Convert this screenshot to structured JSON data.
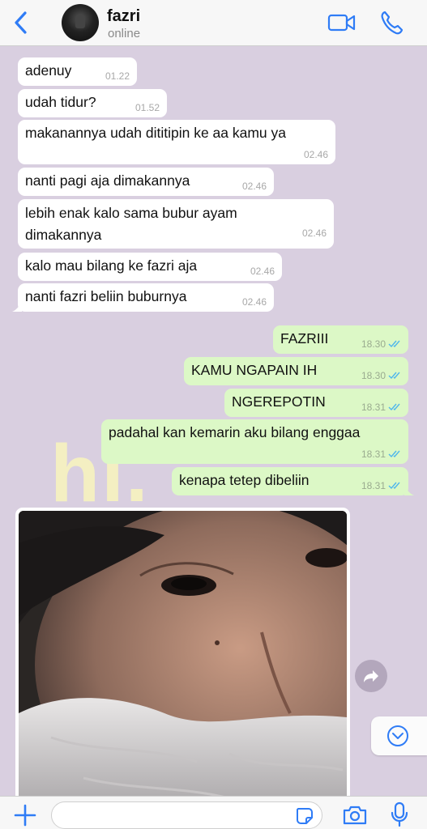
{
  "header": {
    "contact_name": "fazri",
    "contact_status": "online",
    "icons": [
      "back-chevron-icon",
      "avatar",
      "video-call-icon",
      "phone-call-icon"
    ]
  },
  "chat": {
    "background_overlay_text": "hi.",
    "messages": [
      {
        "direction": "in",
        "text": "adenuy",
        "time": "01.22"
      },
      {
        "direction": "in",
        "text": "udah tidur?",
        "time": "01.52"
      },
      {
        "direction": "in",
        "text": "makanannya udah dititipin ke aa kamu ya",
        "time": "02.46"
      },
      {
        "direction": "in",
        "text": "nanti pagi aja dimakannya",
        "time": "02.46"
      },
      {
        "direction": "in",
        "text": "lebih enak kalo sama bubur ayam dimakannya",
        "time": "02.46"
      },
      {
        "direction": "in",
        "text": "kalo mau bilang ke fazri aja",
        "time": "02.46"
      },
      {
        "direction": "in",
        "text": "nanti fazri beliin buburnya",
        "time": "02.46"
      },
      {
        "direction": "out",
        "text": "FAZRIII",
        "time": "18.30",
        "status": "read"
      },
      {
        "direction": "out",
        "text": "KAMU NGAPAIN IH",
        "time": "18.30",
        "status": "read"
      },
      {
        "direction": "out",
        "text": "NGEREPOTIN",
        "time": "18.31",
        "status": "read"
      },
      {
        "direction": "out",
        "text": "padahal kan kemarin aku bilang enggaa",
        "time": "18.31",
        "status": "read"
      },
      {
        "direction": "out",
        "text": "kenapa tetep dibeliin",
        "time": "18.31",
        "status": "read"
      }
    ]
  },
  "colors": {
    "incoming_bubble": "#ffffff",
    "outgoing_bubble": "#dcf8c6",
    "wallpaper": "#d9cfe0",
    "accent_blue": "#2f7cf6",
    "read_ticks": "#4fb6ec"
  },
  "composer": {
    "placeholder": "",
    "icons": [
      "plus-icon",
      "sticker-icon",
      "camera-icon",
      "microphone-icon"
    ]
  }
}
